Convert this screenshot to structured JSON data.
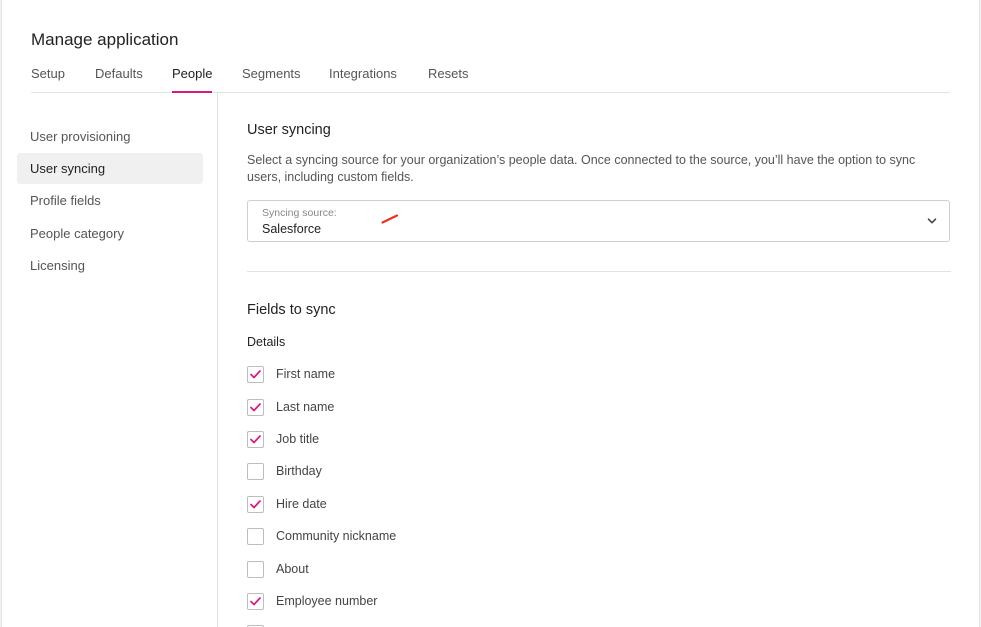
{
  "page": {
    "title": "Manage application"
  },
  "tabs": [
    {
      "label": "Setup",
      "active": false
    },
    {
      "label": "Defaults",
      "active": false
    },
    {
      "label": "People",
      "active": true
    },
    {
      "label": "Segments",
      "active": false
    },
    {
      "label": "Integrations",
      "active": false
    },
    {
      "label": "Resets",
      "active": false
    }
  ],
  "sidebar": {
    "items": [
      {
        "label": "User provisioning",
        "active": false
      },
      {
        "label": "User syncing",
        "active": true
      },
      {
        "label": "Profile fields",
        "active": false
      },
      {
        "label": "People category",
        "active": false
      },
      {
        "label": "Licensing",
        "active": false
      }
    ]
  },
  "user_syncing": {
    "title": "User syncing",
    "description": "Select a syncing source for your organization’s people data. Once connected to the source, you’ll have the option to sync users, including custom fields.",
    "source_label": "Syncing source:",
    "source_value": "Salesforce"
  },
  "fields": {
    "title": "Fields to sync",
    "group_label": "Details",
    "items": [
      {
        "label": "First name",
        "checked": true
      },
      {
        "label": "Last name",
        "checked": true
      },
      {
        "label": "Job title",
        "checked": true
      },
      {
        "label": "Birthday",
        "checked": false
      },
      {
        "label": "Hire date",
        "checked": true
      },
      {
        "label": "Community nickname",
        "checked": false
      },
      {
        "label": "About",
        "checked": false
      },
      {
        "label": "Employee number",
        "checked": true
      }
    ]
  },
  "colors": {
    "accent": "#d6197b",
    "annotation": "#e8321e"
  },
  "icons": {
    "select": "chevron-down-icon",
    "checkbox": "check-icon"
  }
}
